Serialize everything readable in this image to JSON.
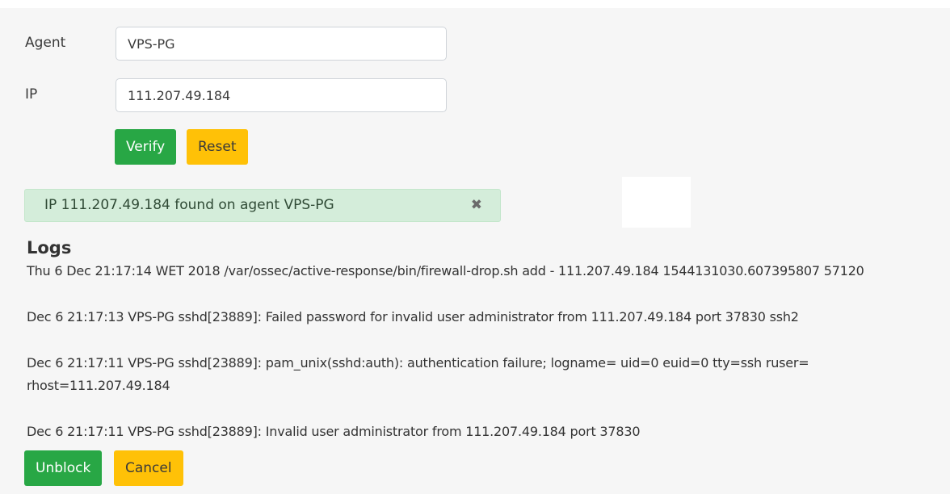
{
  "form": {
    "agent_label": "Agent",
    "agent_value": "VPS-PG",
    "ip_label": "IP",
    "ip_value": "111.207.49.184"
  },
  "actions": {
    "verify_label": "Verify",
    "reset_label": "Reset"
  },
  "alert": {
    "message": "IP 111.207.49.184 found on agent VPS-PG",
    "close_symbol": "✖"
  },
  "logs": {
    "title": "Logs",
    "lines": [
      "Thu 6 Dec 21:17:14 WET 2018 /var/ossec/active-response/bin/firewall-drop.sh add - 111.207.49.184 1544131030.607395807 57120",
      "Dec 6 21:17:13 VPS-PG sshd[23889]: Failed password for invalid user administrator from 111.207.49.184 port 37830 ssh2",
      "Dec 6 21:17:11 VPS-PG sshd[23889]: pam_unix(sshd:auth): authentication failure; logname= uid=0 euid=0 tty=ssh ruser= rhost=111.207.49.184",
      "Dec 6 21:17:11 VPS-PG sshd[23889]: Invalid user administrator from 111.207.49.184 port 37830"
    ]
  },
  "footer_actions": {
    "unblock_label": "Unblock",
    "cancel_label": "Cancel"
  },
  "colors": {
    "green": "#28a745",
    "yellow": "#ffc107",
    "alert_bg": "#d4edda"
  }
}
